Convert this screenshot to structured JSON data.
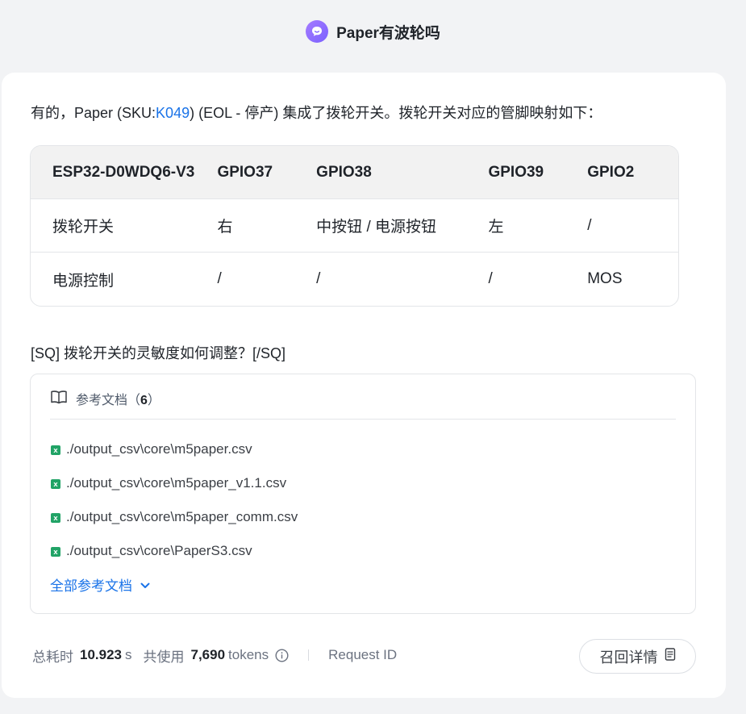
{
  "question": {
    "text": "Paper有波轮吗"
  },
  "answer": {
    "intro_before": "有的，Paper (SKU:",
    "sku_link": "K049",
    "intro_after": ") (EOL - 停产) 集成了拨轮开关。拨轮开关对应的管脚映射如下："
  },
  "table": {
    "headers": [
      "ESP32-D0WDQ6-V3",
      "GPIO37",
      "GPIO38",
      "GPIO39",
      "GPIO2"
    ],
    "rows": [
      [
        "拨轮开关",
        "右",
        "中按钮 / 电源按钮",
        "左",
        "/"
      ],
      [
        "电源控制",
        "/",
        "/",
        "/",
        "MOS"
      ]
    ]
  },
  "sq_line": "[SQ] 拨轮开关的灵敏度如何调整？[/SQ]",
  "references": {
    "title": "参考文档（",
    "count": "6",
    "title_close": "）",
    "items": [
      "./output_csv\\core\\m5paper.csv",
      "./output_csv\\core\\m5paper_v1.1.csv",
      "./output_csv\\core\\m5paper_comm.csv",
      "./output_csv\\core\\PaperS3.csv"
    ],
    "all_label": "全部参考文档"
  },
  "stats": {
    "time_label": "总耗时",
    "time_value": "10.923",
    "time_unit": "s",
    "tokens_label": "共使用",
    "tokens_value": "7,690",
    "tokens_unit": "tokens",
    "request_id_label": "Request ID"
  },
  "recall_button": "召回详情",
  "colors": {
    "accent": "#1a73e8",
    "avatar": "#7b61ff",
    "excel": "#21a366"
  }
}
